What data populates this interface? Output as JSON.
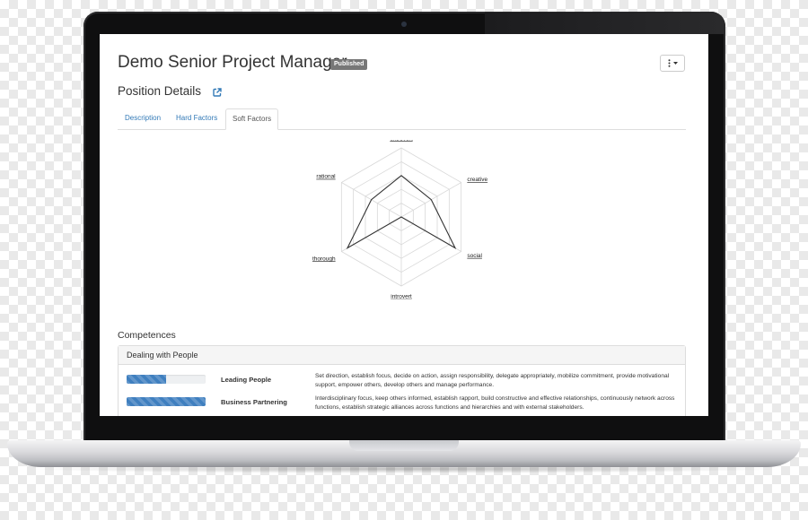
{
  "header": {
    "title": "Demo Senior Project Manager",
    "status_badge": "Published",
    "options_icon": "vertical-ellipsis-icon",
    "options_caret": "caret-down-icon"
  },
  "position": {
    "section_title": "Position Details",
    "link_icon": "external-link-icon"
  },
  "tabs": [
    {
      "label": "Description",
      "active": false
    },
    {
      "label": "Hard Factors",
      "active": false
    },
    {
      "label": "Soft Factors",
      "active": true
    }
  ],
  "chart_data": {
    "type": "radar",
    "axes": [
      "extrovert",
      "creative",
      "social",
      "introvert",
      "thorough",
      "rational"
    ],
    "rings": 5,
    "rlim": [
      0,
      5
    ],
    "series": [
      {
        "values": [
          3,
          2.5,
          4.5,
          0,
          4.5,
          2.5
        ]
      }
    ],
    "colors": {
      "line": "#333333",
      "grid": "#d8d8d8"
    }
  },
  "competences": {
    "title": "Competences",
    "groups": [
      {
        "name": "Dealing with People",
        "items": [
          {
            "name": "Leading People",
            "level": 0.5,
            "description": "Set direction, establish focus, decide on action, assign responsibility, delegate appropriately, mobilize commitment, provide motivational support, empower others, develop others and manage performance."
          },
          {
            "name": "Business Partnering",
            "level": 1.0,
            "description": "Interdisciplinary focus, keep others informed, establish rapport, build constructive and effective relationships, continuously network across functions, establish strategic alliances across functions and hierarchies and with external stakeholders."
          }
        ]
      }
    ]
  },
  "colors": {
    "link": "#337ab7",
    "badge": "#777777",
    "progress": "#3f7fbf",
    "bezel": "#0f0f10"
  }
}
